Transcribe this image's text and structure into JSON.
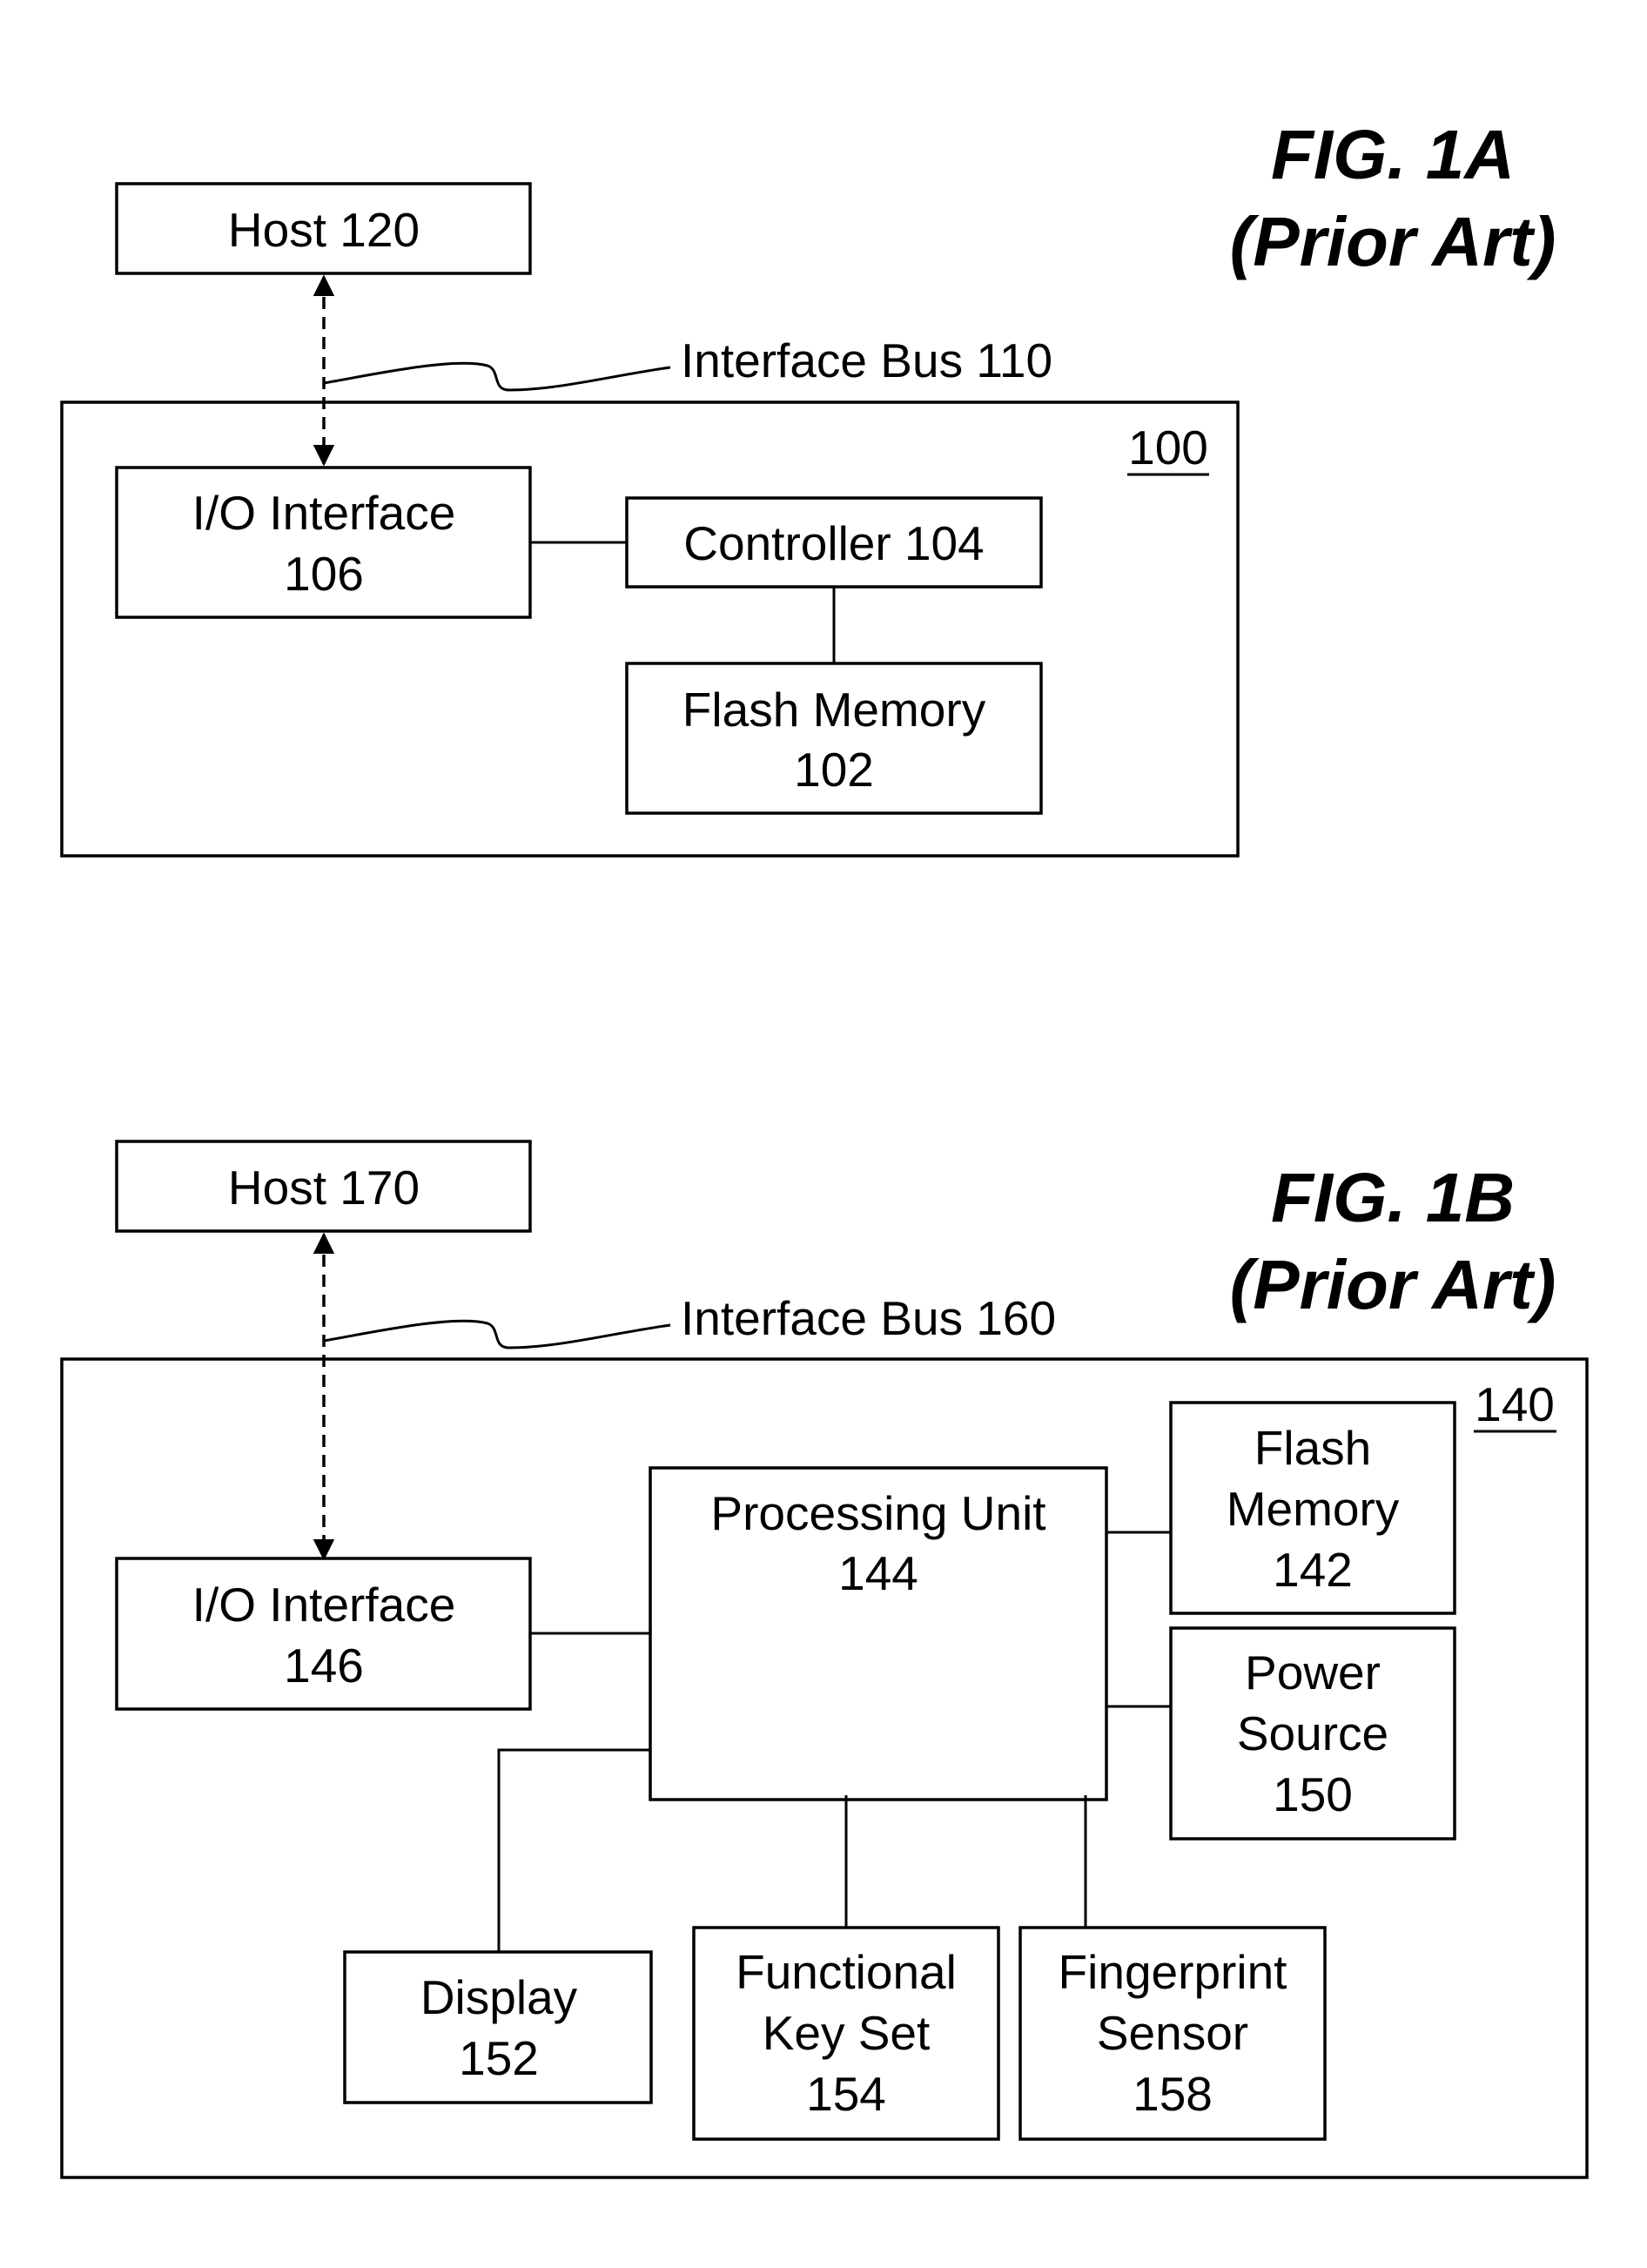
{
  "fig1a": {
    "title": "FIG. 1A",
    "subtitle": "(Prior Art)",
    "host": "Host 120",
    "bus": "Interface Bus 110",
    "device_ref": "100",
    "io": [
      "I/O Interface",
      "106"
    ],
    "controller": "Controller 104",
    "flash": [
      "Flash Memory",
      "102"
    ]
  },
  "fig1b": {
    "title": "FIG. 1B",
    "subtitle": "(Prior Art)",
    "host": "Host 170",
    "bus": "Interface Bus 160",
    "device_ref": "140",
    "io": [
      "I/O Interface",
      "146"
    ],
    "processing": [
      "Processing Unit",
      "144"
    ],
    "flash": [
      "Flash",
      "Memory",
      "142"
    ],
    "power": [
      "Power",
      "Source",
      "150"
    ],
    "display": [
      "Display",
      "152"
    ],
    "keyset": [
      "Functional",
      "Key Set",
      "154"
    ],
    "fingerprint": [
      "Fingerprint",
      "Sensor",
      "158"
    ]
  }
}
